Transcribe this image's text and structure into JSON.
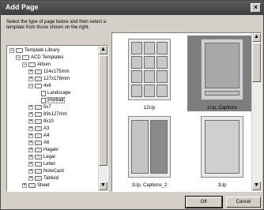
{
  "window": {
    "title": "Add Page",
    "close_label": "×"
  },
  "instructions": "Select the type of page below and then select a template from those shown on the right.",
  "tree": [
    {
      "label": "Template Library",
      "indent": 0,
      "expander": "−",
      "icon": "folder-open",
      "selected": false
    },
    {
      "label": "ACD Templates",
      "indent": 1,
      "expander": "−",
      "icon": "folder-open",
      "selected": false
    },
    {
      "label": "Album",
      "indent": 2,
      "expander": "−",
      "icon": "folder-open",
      "selected": false
    },
    {
      "label": "114x175mm",
      "indent": 3,
      "expander": "+",
      "icon": "folder",
      "selected": false
    },
    {
      "label": "127x178mm",
      "indent": 3,
      "expander": "+",
      "icon": "folder",
      "selected": false
    },
    {
      "label": "4x6",
      "indent": 3,
      "expander": "−",
      "icon": "folder-open",
      "selected": false
    },
    {
      "label": "Landscape",
      "indent": 4,
      "expander": "",
      "icon": "doc",
      "selected": false
    },
    {
      "label": "Portrait",
      "indent": 4,
      "expander": "",
      "icon": "doc",
      "selected": true
    },
    {
      "label": "5x7",
      "indent": 3,
      "expander": "+",
      "icon": "folder",
      "selected": false
    },
    {
      "label": "89x127mm",
      "indent": 3,
      "expander": "+",
      "icon": "folder",
      "selected": false
    },
    {
      "label": "8x10",
      "indent": 3,
      "expander": "+",
      "icon": "folder",
      "selected": false
    },
    {
      "label": "A3",
      "indent": 3,
      "expander": "+",
      "icon": "folder",
      "selected": false
    },
    {
      "label": "A4",
      "indent": 3,
      "expander": "+",
      "icon": "folder",
      "selected": false
    },
    {
      "label": "A6",
      "indent": 3,
      "expander": "+",
      "icon": "folder",
      "selected": false
    },
    {
      "label": "Hagaki",
      "indent": 3,
      "expander": "+",
      "icon": "folder",
      "selected": false
    },
    {
      "label": "Legal",
      "indent": 3,
      "expander": "+",
      "icon": "folder",
      "selected": false
    },
    {
      "label": "Letter",
      "indent": 3,
      "expander": "+",
      "icon": "folder",
      "selected": false
    },
    {
      "label": "NoteCard",
      "indent": 3,
      "expander": "+",
      "icon": "folder",
      "selected": false
    },
    {
      "label": "Tabloid",
      "indent": 3,
      "expander": "+",
      "icon": "folder",
      "selected": false
    },
    {
      "label": "Sheet",
      "indent": 2,
      "expander": "+",
      "icon": "folder",
      "selected": false
    }
  ],
  "templates": [
    {
      "label": "12Up",
      "selected": false
    },
    {
      "label": "1Up, Captions",
      "selected": true
    },
    {
      "label": "1Up, Captions_2",
      "selected": false
    },
    {
      "label": "1Up",
      "selected": false
    }
  ],
  "buttons": {
    "ok": "OK",
    "cancel": "Cancel"
  },
  "scroll_arrows": {
    "up": "▲",
    "down": "▼"
  },
  "colors": {
    "titlebar": "#4a4a4a",
    "selected_template": "#7e7e7e"
  }
}
